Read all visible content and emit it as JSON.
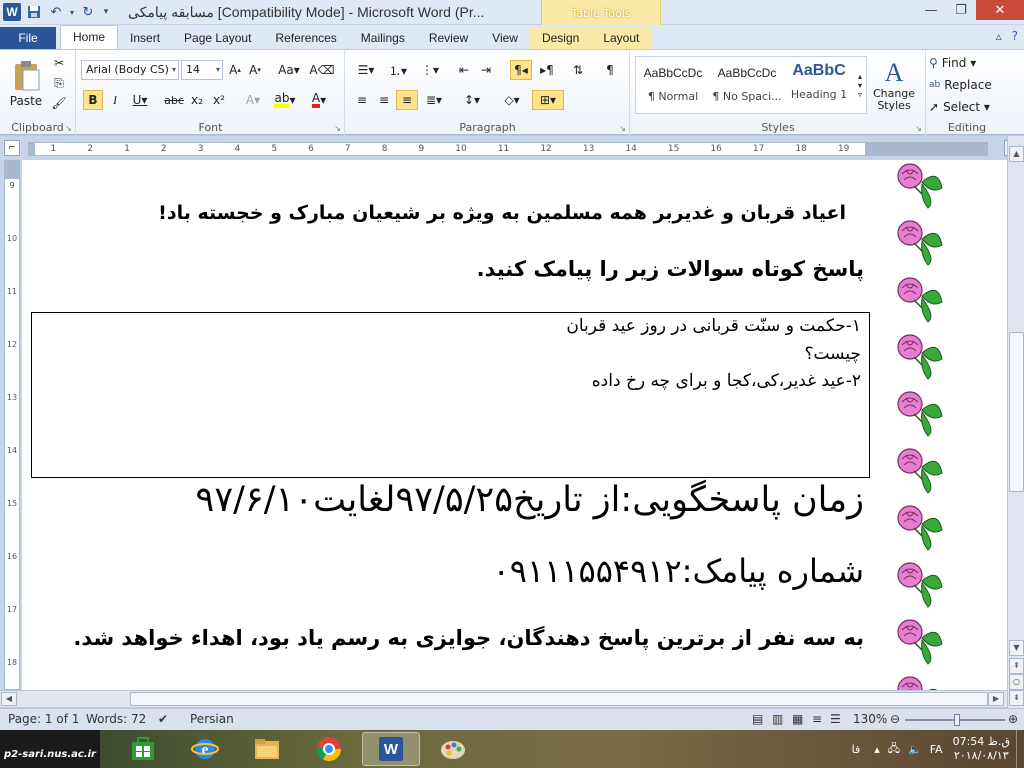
{
  "window": {
    "title": "مسابقه پیامکی [Compatibility Mode]  -  Microsoft Word (Pr...",
    "contextual_header": "Table Tools"
  },
  "tabs": [
    "File",
    "Home",
    "Insert",
    "Page Layout",
    "References",
    "Mailings",
    "Review",
    "View",
    "Design",
    "Layout"
  ],
  "ribbon": {
    "clipboard": {
      "label": "Clipboard",
      "paste": "Paste"
    },
    "font": {
      "label": "Font",
      "name": "Arial (Body CS)",
      "size": "14"
    },
    "paragraph": {
      "label": "Paragraph"
    },
    "styles": {
      "label": "Styles",
      "items": [
        {
          "sample": "AaBbCcDc",
          "name": "¶ Normal"
        },
        {
          "sample": "AaBbCcDc",
          "name": "¶ No Spaci..."
        },
        {
          "sample": "AaBbC",
          "name": "Heading 1"
        }
      ],
      "change_styles": "Change Styles"
    },
    "editing": {
      "label": "Editing",
      "find": "Find",
      "replace": "Replace",
      "select": "Select"
    }
  },
  "ruler": {
    "h_numbers": [
      "1",
      "2",
      "1",
      "2",
      "3",
      "4",
      "5",
      "6",
      "7",
      "8",
      "9",
      "10",
      "11",
      "12",
      "13",
      "14",
      "15",
      "16",
      "17",
      "18",
      "19"
    ],
    "v_numbers": [
      "9",
      "10",
      "11",
      "12",
      "13",
      "14",
      "15",
      "16",
      "17",
      "18"
    ]
  },
  "document": {
    "line1": "اعیاد قربان و غدیربر همه مسلمین به ویژه بر شیعیان مبارک و خجسته باد!",
    "line2": "پاسخ کوتاه سوالات زیر را پیامک کنید.",
    "questions": [
      "۱-حکمت و سنّت قربانی در روز عید قربان",
      "چیست؟",
      "۲-عید غدیر،کی،کجا و برای چه رخ داده"
    ],
    "line3": "زمان پاسخگویی:از تاریخ۹۷/۵/۲۵لغایت۹۷/۶/۱۰",
    "line4": "شماره پیامک:۰۹۱۱۱۵۵۴۹۱۲",
    "line5": "به سه نفر از برترین پاسخ دهندگان، جوایزی به رسم یاد بود، اهداء خواهد شد."
  },
  "statusbar": {
    "page": "Page: 1 of 1",
    "words": "Words: 72",
    "language": "Persian",
    "zoom": "130%",
    "zoom_level_fraction": 0.52
  },
  "taskbar": {
    "start_text": "p2-sari.nus.ac.ir",
    "lang": "FA",
    "time": "07:54 ق.ظ",
    "date": "۲۰۱۸/۰۸/۱۳",
    "tray_text": "فا"
  },
  "colors": {
    "file_tab": "#2a5699",
    "contextual": "#fbe9a8",
    "flower_pink": "#e77fcf",
    "leaf_green": "#3aa83a"
  }
}
